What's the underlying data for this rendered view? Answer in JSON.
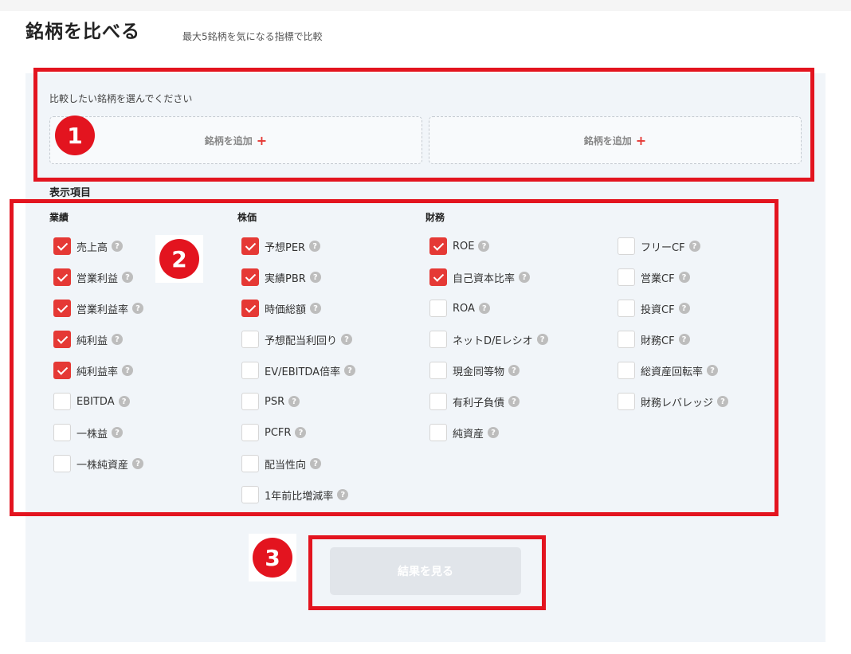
{
  "header": {
    "title": "銘柄を比べる",
    "subtitle": "最大5銘柄を気になる指標で比較"
  },
  "selection": {
    "instruction": "比較したい銘柄を選んでください",
    "slots": [
      {
        "label": "銘柄を追加",
        "plus": "+"
      },
      {
        "label": "銘柄を追加",
        "plus": "+"
      }
    ]
  },
  "display_items": {
    "heading": "表示項目",
    "help_glyph": "?",
    "groups": [
      {
        "heading": "業績",
        "items": [
          {
            "label": "売上高",
            "checked": true
          },
          {
            "label": "営業利益",
            "checked": true
          },
          {
            "label": "営業利益率",
            "checked": true
          },
          {
            "label": "純利益",
            "checked": true
          },
          {
            "label": "純利益率",
            "checked": true
          },
          {
            "label": "EBITDA",
            "checked": false
          },
          {
            "label": "一株益",
            "checked": false
          },
          {
            "label": "一株純資産",
            "checked": false
          }
        ]
      },
      {
        "heading": "株価",
        "items": [
          {
            "label": "予想PER",
            "checked": true
          },
          {
            "label": "実績PBR",
            "checked": true
          },
          {
            "label": "時価総額",
            "checked": true
          },
          {
            "label": "予想配当利回り",
            "checked": false
          },
          {
            "label": "EV/EBITDA倍率",
            "checked": false
          },
          {
            "label": "PSR",
            "checked": false
          },
          {
            "label": "PCFR",
            "checked": false
          },
          {
            "label": "配当性向",
            "checked": false
          },
          {
            "label": "1年前比増減率",
            "checked": false
          }
        ]
      },
      {
        "heading": "財務",
        "items": [
          {
            "label": "ROE",
            "checked": true
          },
          {
            "label": "自己資本比率",
            "checked": true
          },
          {
            "label": "ROA",
            "checked": false
          },
          {
            "label": "ネットD/Eレシオ",
            "checked": false
          },
          {
            "label": "現金同等物",
            "checked": false
          },
          {
            "label": "有利子負債",
            "checked": false
          },
          {
            "label": "純資産",
            "checked": false
          }
        ]
      },
      {
        "heading": "",
        "items": [
          {
            "label": "フリーCF",
            "checked": false
          },
          {
            "label": "営業CF",
            "checked": false
          },
          {
            "label": "投資CF",
            "checked": false
          },
          {
            "label": "財務CF",
            "checked": false
          },
          {
            "label": "総資産回転率",
            "checked": false
          },
          {
            "label": "財務レバレッジ",
            "checked": false
          }
        ]
      }
    ]
  },
  "actions": {
    "result_label": "結果を見る"
  },
  "annotations": {
    "badge_1": "1",
    "badge_2": "2",
    "badge_3": "3",
    "highlight_color": "#e3141f"
  },
  "colors": {
    "accent": "#e53935",
    "panel_bg": "#f1f5f9",
    "button_disabled": "#e1e5ea"
  }
}
